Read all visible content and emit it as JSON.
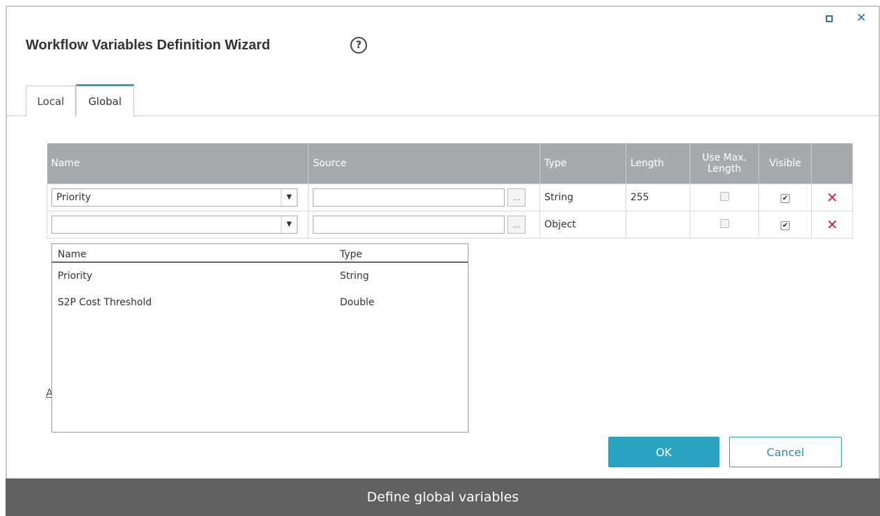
{
  "dialog": {
    "title": "Workflow Variables Definition Wizard",
    "help_symbol": "?",
    "close_symbol": "✕"
  },
  "tabs": [
    {
      "label": "Local"
    },
    {
      "label": "Global"
    }
  ],
  "table": {
    "headers": {
      "name": "Name",
      "source": "Source",
      "type": "Type",
      "length": "Length",
      "use_max_length": "Use Max. Length",
      "visible": "Visible"
    },
    "rows": [
      {
        "name": "Priority",
        "source": "",
        "type": "String",
        "length": "255",
        "use_max_length": false,
        "visible": true
      },
      {
        "name": "",
        "source": "",
        "type": "Object",
        "length": "",
        "use_max_length": false,
        "visible": true
      }
    ],
    "browse_label": "...",
    "delete_symbol": "✕"
  },
  "dropdown": {
    "headers": {
      "name": "Name",
      "type": "Type"
    },
    "items": [
      {
        "name": "Priority",
        "type": "String"
      },
      {
        "name": "S2P Cost Threshold",
        "type": "Double"
      }
    ]
  },
  "link_fragment": "A",
  "buttons": {
    "ok": "OK",
    "cancel": "Cancel"
  },
  "caption": "Define global variables",
  "colors": {
    "accent": "#2aa3c0",
    "header_bg": "#a6aaad",
    "delete": "#d9252b",
    "caption_bg": "#616161"
  }
}
